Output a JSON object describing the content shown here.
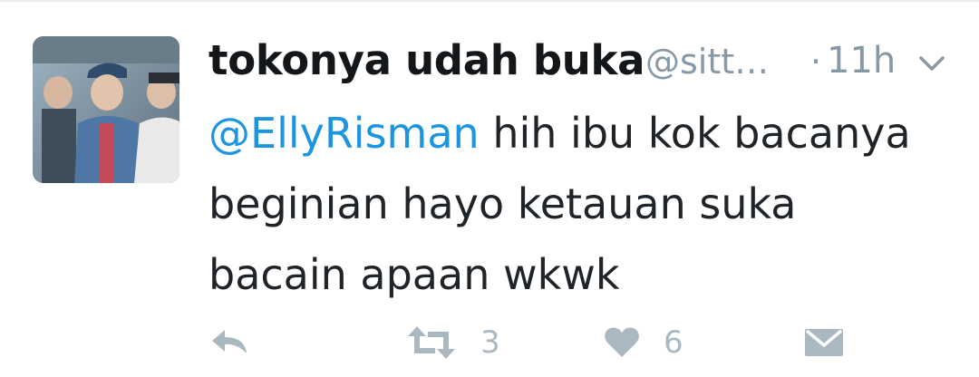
{
  "tweet": {
    "display_name": "tokonya udah buka",
    "handle": "@sitt…",
    "separator": "·",
    "time": "11h",
    "mention": "@EllyRisman",
    "text_line1_rest": " hih ibu kok bacanya",
    "text_line2": "beginian hayo ketauan suka",
    "text_line3": "bacain apaan wkwk"
  },
  "actions": {
    "reply_icon": "reply-icon",
    "retweet_icon": "retweet-icon",
    "retweet_count": "3",
    "like_icon": "heart-icon",
    "like_count": "6",
    "dm_icon": "envelope-icon"
  },
  "colors": {
    "mention": "#1b95e0",
    "muted": "#8899a6",
    "icon": "#aab8c2",
    "text": "#1f2429"
  }
}
